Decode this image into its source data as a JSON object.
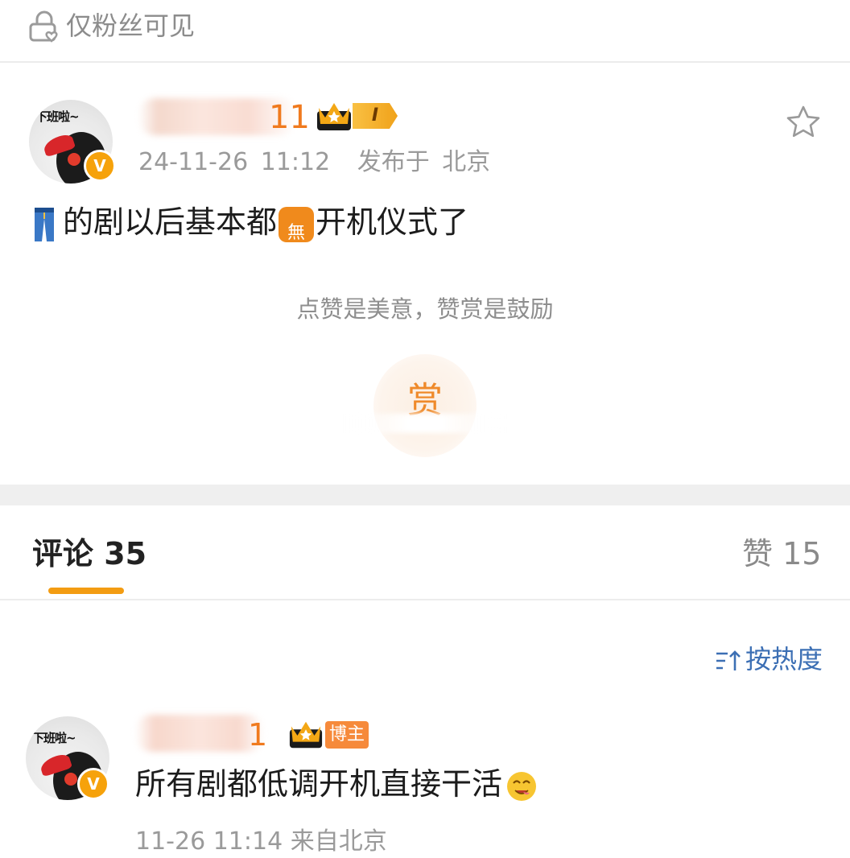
{
  "visibility": {
    "label": "仅粉丝可见",
    "icon": "lock-heart-icon"
  },
  "post": {
    "author_visible_suffix": "11",
    "author_level": "I",
    "avatar_caption": "下班啦~",
    "verified_mark": "V",
    "timestamp": "24-11-26 11:12",
    "location": "发布于 北京",
    "body_icon": "jeans-icon",
    "body_part1": "的剧以后基本都",
    "body_emoji_char": "無",
    "body_part2": "开机仪式了",
    "reward_hint": "点赞是美意，赞赏是鼓励",
    "reward_char": "赏"
  },
  "tabs": {
    "comments_label": "评论 35",
    "likes_label": "赞 15"
  },
  "sort": {
    "label": "按热度",
    "icon": "sort-icon"
  },
  "comment": {
    "author_visible_suffix": "1",
    "avatar_caption": "下班啦~",
    "verified_mark": "V",
    "tag": "博主",
    "text": "所有剧都低调开机直接干活",
    "timestamp_location": "11-26 11:14  来自北京"
  },
  "colors": {
    "accent": "#f39c12",
    "name": "#f07a1e",
    "link": "#3c6fb4",
    "muted": "#9a9a9a"
  }
}
